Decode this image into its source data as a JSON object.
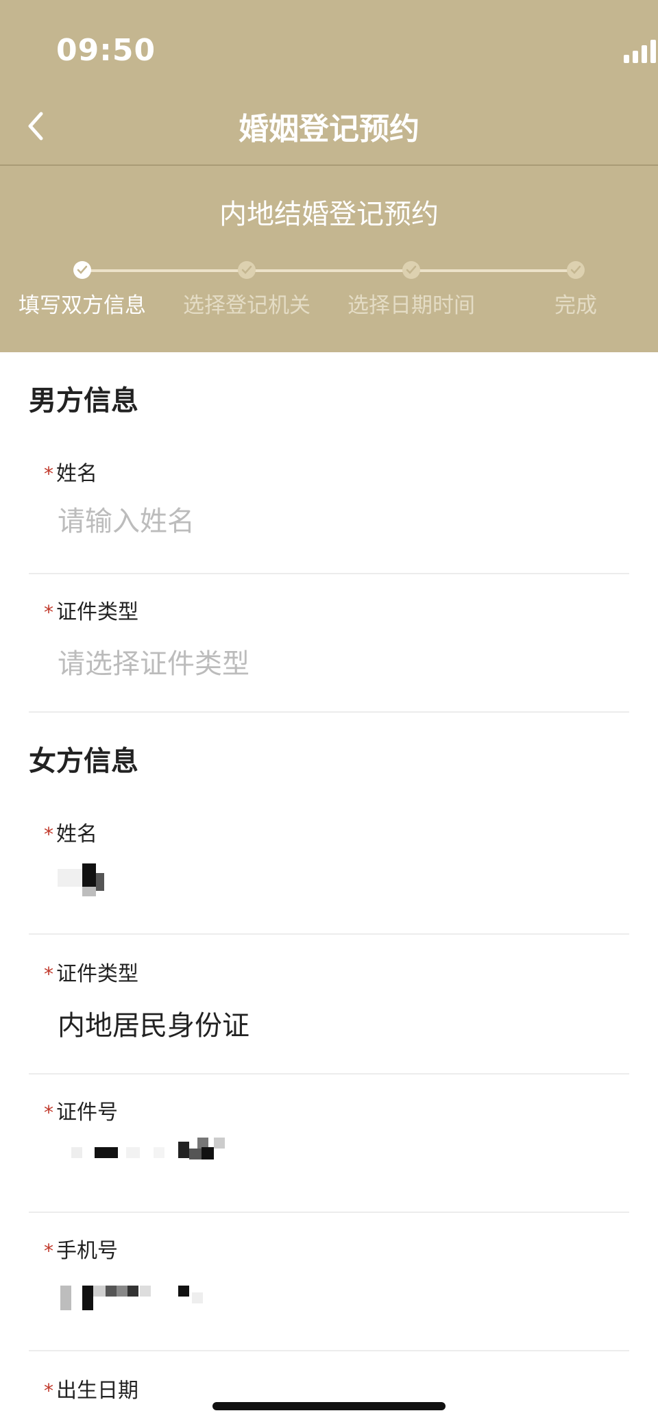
{
  "status_bar": {
    "time": "09:50",
    "icons": [
      "signal-icon",
      "wifi-icon",
      "battery-icon"
    ]
  },
  "nav": {
    "back_icon": "chevron-left-icon",
    "title": "婚姻登记预约"
  },
  "subtitle": "内地结婚登记预约",
  "steps": [
    {
      "label": "填写双方信息",
      "state": "done"
    },
    {
      "label": "选择登记机关",
      "state": "todo"
    },
    {
      "label": "选择日期时间",
      "state": "todo"
    },
    {
      "label": "完成",
      "state": "todo"
    }
  ],
  "male": {
    "title": "男方信息",
    "name_label": "姓名",
    "name_placeholder": "请输入姓名",
    "id_type_label": "证件类型",
    "id_type_placeholder": "请选择证件类型"
  },
  "female": {
    "title": "女方信息",
    "name_label": "姓名",
    "id_type_label": "证件类型",
    "id_type_value": "内地居民身份证",
    "id_no_label": "证件号",
    "phone_label": "手机号",
    "birth_label": "出生日期"
  },
  "required_mark": "*",
  "colors": {
    "header_bg": "#c4b690",
    "required": "#c0392b",
    "placeholder": "#bcbcbc"
  }
}
